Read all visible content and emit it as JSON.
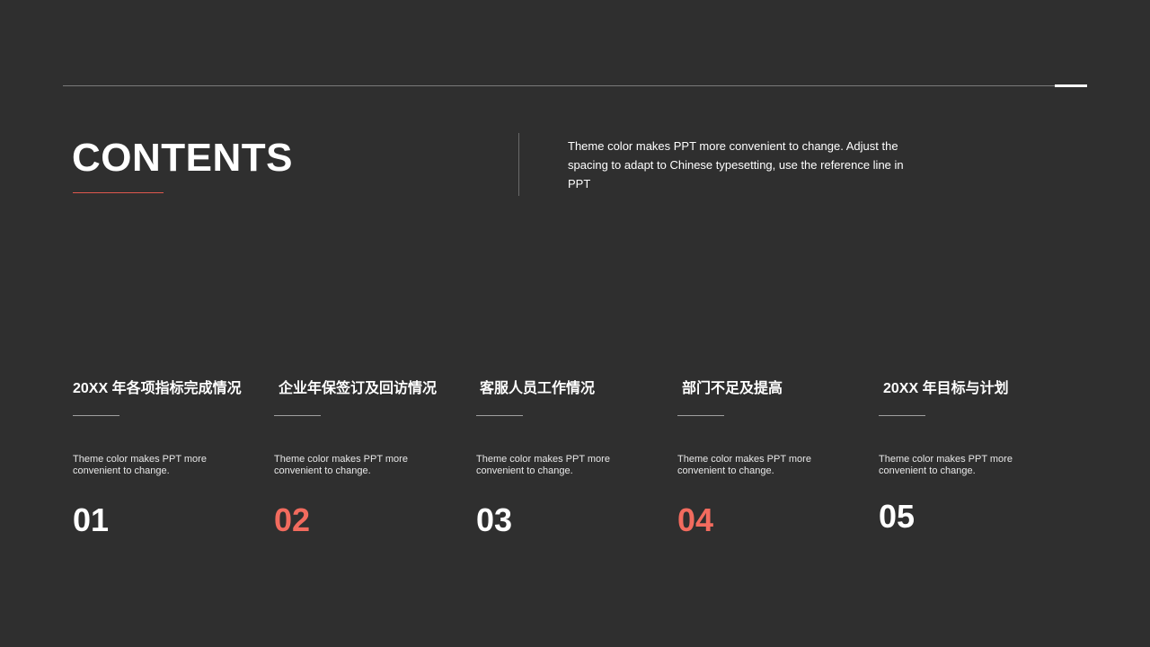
{
  "header": {
    "title": "CONTENTS",
    "description": "Theme color makes PPT more convenient to change. Adjust the spacing to adapt to Chinese typesetting, use the reference line in PPT"
  },
  "colors": {
    "background": "#2f2f2f",
    "accent": "#f26b5e",
    "text": "#ffffff"
  },
  "items": [
    {
      "heading": "20XX 年各项指标完成情况",
      "description": "Theme color makes PPT more convenient to change.",
      "number": "01"
    },
    {
      "heading": "企业年保签订及回访情况",
      "description": "Theme color makes PPT more convenient to change.",
      "number": "02"
    },
    {
      "heading": "客服人员工作情况",
      "description": "Theme color makes PPT more convenient to change.",
      "number": "03"
    },
    {
      "heading": "部门不足及提高",
      "description": "Theme color makes PPT more convenient to change.",
      "number": "04"
    },
    {
      "heading": "20XX 年目标与计划",
      "description": "Theme color makes PPT more convenient to change.",
      "number": "05"
    }
  ]
}
